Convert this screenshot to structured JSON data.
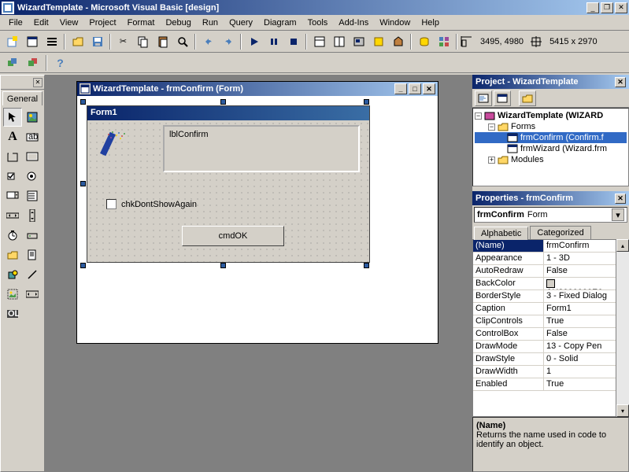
{
  "app": {
    "title": "WizardTemplate - Microsoft Visual Basic [design]"
  },
  "menu": [
    "File",
    "Edit",
    "View",
    "Project",
    "Format",
    "Debug",
    "Run",
    "Query",
    "Diagram",
    "Tools",
    "Add-Ins",
    "Window",
    "Help"
  ],
  "status": {
    "pos": "3495, 4980",
    "size": "5415 x 2970"
  },
  "toolbox": {
    "tab": "General"
  },
  "designer": {
    "window_title": "WizardTemplate - frmConfirm (Form)",
    "form_caption": "Form1",
    "lblConfirm": "lblConfirm",
    "chkDontShowAgain": "chkDontShowAgain",
    "cmdOK": "cmdOK"
  },
  "project_panel": {
    "title": "Project - WizardTemplate",
    "root": "WizardTemplate (WIZARD",
    "forms_folder": "Forms",
    "frmConfirm": "frmConfirm (Confirm.f",
    "frmWizard": "frmWizard (Wizard.frm",
    "modules_folder": "Modules"
  },
  "properties_panel": {
    "title": "Properties - frmConfirm",
    "object": "frmConfirm",
    "object_type": "Form",
    "tabs": [
      "Alphabetic",
      "Categorized"
    ],
    "rows": [
      {
        "n": "(Name)",
        "v": "frmConfirm",
        "sel": true
      },
      {
        "n": "Appearance",
        "v": "1 - 3D"
      },
      {
        "n": "AutoRedraw",
        "v": "False"
      },
      {
        "n": "BackColor",
        "v": "&H8000000F&",
        "swatch": true
      },
      {
        "n": "BorderStyle",
        "v": "3 - Fixed Dialog"
      },
      {
        "n": "Caption",
        "v": "Form1"
      },
      {
        "n": "ClipControls",
        "v": "True"
      },
      {
        "n": "ControlBox",
        "v": "False"
      },
      {
        "n": "DrawMode",
        "v": "13 - Copy Pen"
      },
      {
        "n": "DrawStyle",
        "v": "0 - Solid"
      },
      {
        "n": "DrawWidth",
        "v": "1"
      },
      {
        "n": "Enabled",
        "v": "True"
      }
    ],
    "help_title": "(Name)",
    "help_text": "Returns the name used in code to identify an object."
  }
}
